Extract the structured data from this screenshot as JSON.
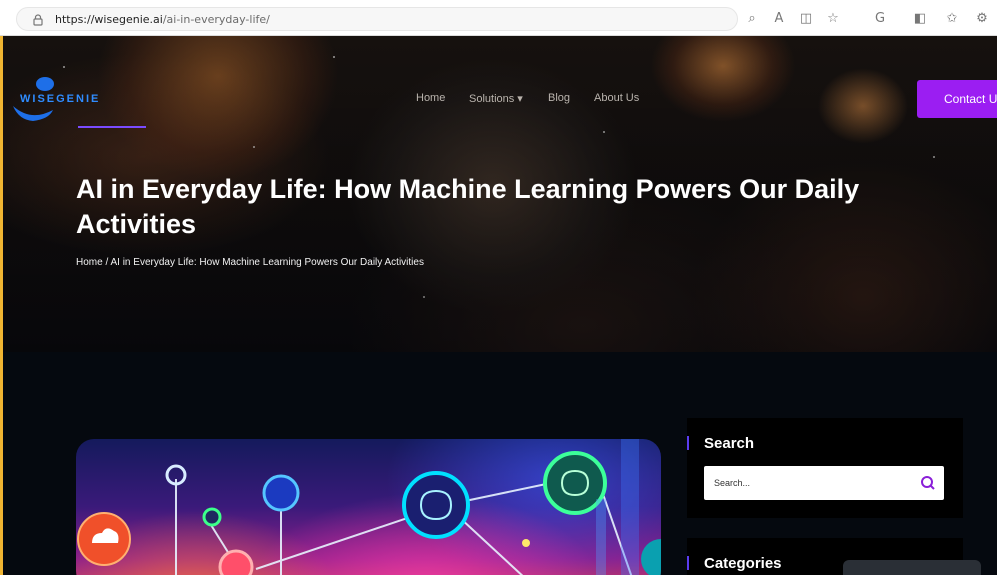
{
  "browser": {
    "url_domain": "https://wisegenie.ai",
    "url_path": "/ai-in-everyday-life/",
    "toolbar_icons": [
      "zoom-icon",
      "read-aloud-icon",
      "reader-view-icon",
      "favorite-star-icon",
      "copilot-icon",
      "split-screen-icon",
      "favorites-icon",
      "extensions-icon"
    ]
  },
  "site": {
    "logo_text": "WISEGENIE",
    "nav": [
      "Home",
      "Solutions ▾",
      "Blog",
      "About Us"
    ],
    "contact_label": "Contact Us",
    "accent_purple": "#9b1ef2",
    "logo_blue": "#2f8cff"
  },
  "hero": {
    "title": "AI in Everyday Life: How Machine Learning Powers Our Daily Activities",
    "breadcrumb_home": "Home",
    "breadcrumb_sep": "/",
    "breadcrumb_current": "AI in Everyday Life: How Machine Learning Powers Our Daily Activities"
  },
  "sidebar": {
    "search_title": "Search",
    "search_placeholder": "Search...",
    "categories_title": "Categories"
  }
}
